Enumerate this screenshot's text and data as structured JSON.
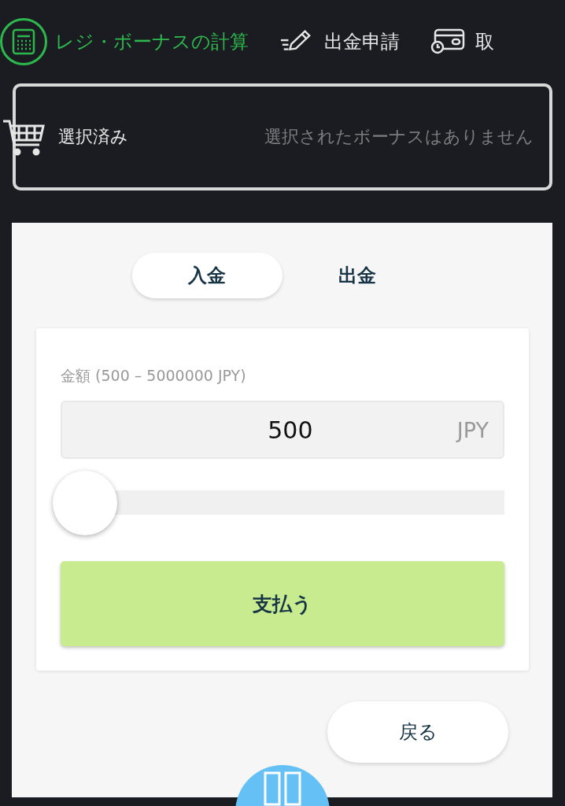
{
  "nav": [
    {
      "kind": "calculator",
      "label": "レジ・ボーナスの計算",
      "selected": true
    },
    {
      "kind": "pencil",
      "label": "出金申請",
      "selected": false
    },
    {
      "kind": "card",
      "label": "取",
      "selected": false
    }
  ],
  "cart": {
    "label": "選択済み",
    "empty_text": "選択されたボーナスはありません"
  },
  "tabs": [
    {
      "label": "入金",
      "selected": true
    },
    {
      "label": "出金",
      "selected": false
    }
  ],
  "amount": {
    "label": "金額 (500 – 5000000 JPY)",
    "value": "500",
    "currency": "JPY",
    "level": 0
  },
  "pay_button": "支払う",
  "back_button": "戻る"
}
